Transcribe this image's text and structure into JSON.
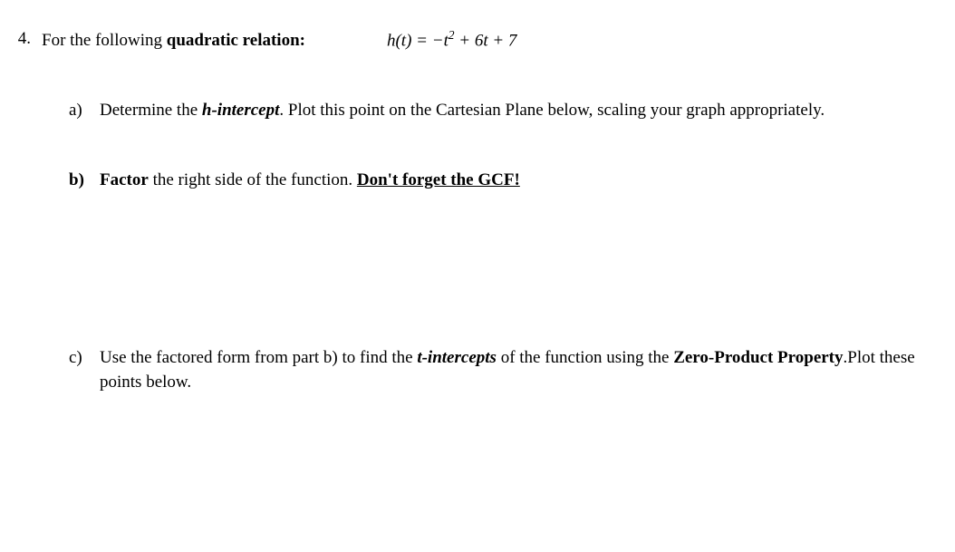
{
  "problem": {
    "number": "4.",
    "intro_pre": "For the following ",
    "intro_bold": "quadratic relation:",
    "equation_lhs": "h(t) = ",
    "equation_rhs_neg": "−t",
    "equation_rhs_exp": "2",
    "equation_rhs_rest": " + 6t + 7"
  },
  "part_a": {
    "label": "a)",
    "pre": "Determine the ",
    "bold": "h-intercept",
    "post": ".  Plot this point on the Cartesian Plane below, scaling your graph appropriately."
  },
  "part_b": {
    "label": "b)",
    "bold1": "Factor",
    "mid": " the right side of the function.  ",
    "underline_bold": "Don't forget the GCF!"
  },
  "part_c": {
    "label": "c)",
    "pre": "Use the factored form from part b) to find the ",
    "bolditalic": "t-intercepts",
    "mid": " of the function using the ",
    "bold2": "Zero-Product Property",
    "post": ".Plot these points below."
  }
}
